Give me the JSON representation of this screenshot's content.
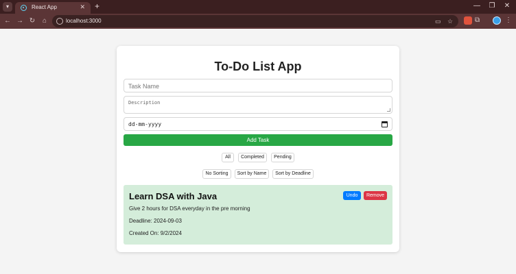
{
  "browser": {
    "tab_title": "React App",
    "tab_close": "✕",
    "new_tab": "+",
    "url": "localhost:3000",
    "window_controls": {
      "minimize": "—",
      "restore": "❐",
      "close": "✕"
    }
  },
  "app": {
    "title": "To-Do List App",
    "form": {
      "task_name_placeholder": "Task Name",
      "description_placeholder": "Description",
      "date_placeholder": "dd-mm-yyyy",
      "add_label": "Add Task"
    },
    "filters": [
      "All",
      "Completed",
      "Pending"
    ],
    "sorts": [
      "No Sorting",
      "Sort by Name",
      "Sort by Deadline"
    ],
    "tasks": [
      {
        "title": "Learn DSA with Java",
        "description": "Give 2 hours for DSA everyday in the pre morning",
        "deadline": "Deadline: 2024-09-03",
        "created": "Created On: 9/2/2024",
        "undo_label": "Undo",
        "remove_label": "Remove",
        "status_color": "#d4edda"
      }
    ]
  },
  "colors": {
    "add_button": "#28a745",
    "undo_button": "#007bff",
    "remove_button": "#dc3545",
    "browser_frame": "#3b1f20"
  },
  "icons": [
    "tab-search-icon",
    "react-favicon",
    "back-icon",
    "forward-icon",
    "reload-icon",
    "home-icon",
    "site-info-icon",
    "cast-icon",
    "star-icon",
    "extensions-icon",
    "profile-icon",
    "menu-icon",
    "calendar-icon"
  ]
}
